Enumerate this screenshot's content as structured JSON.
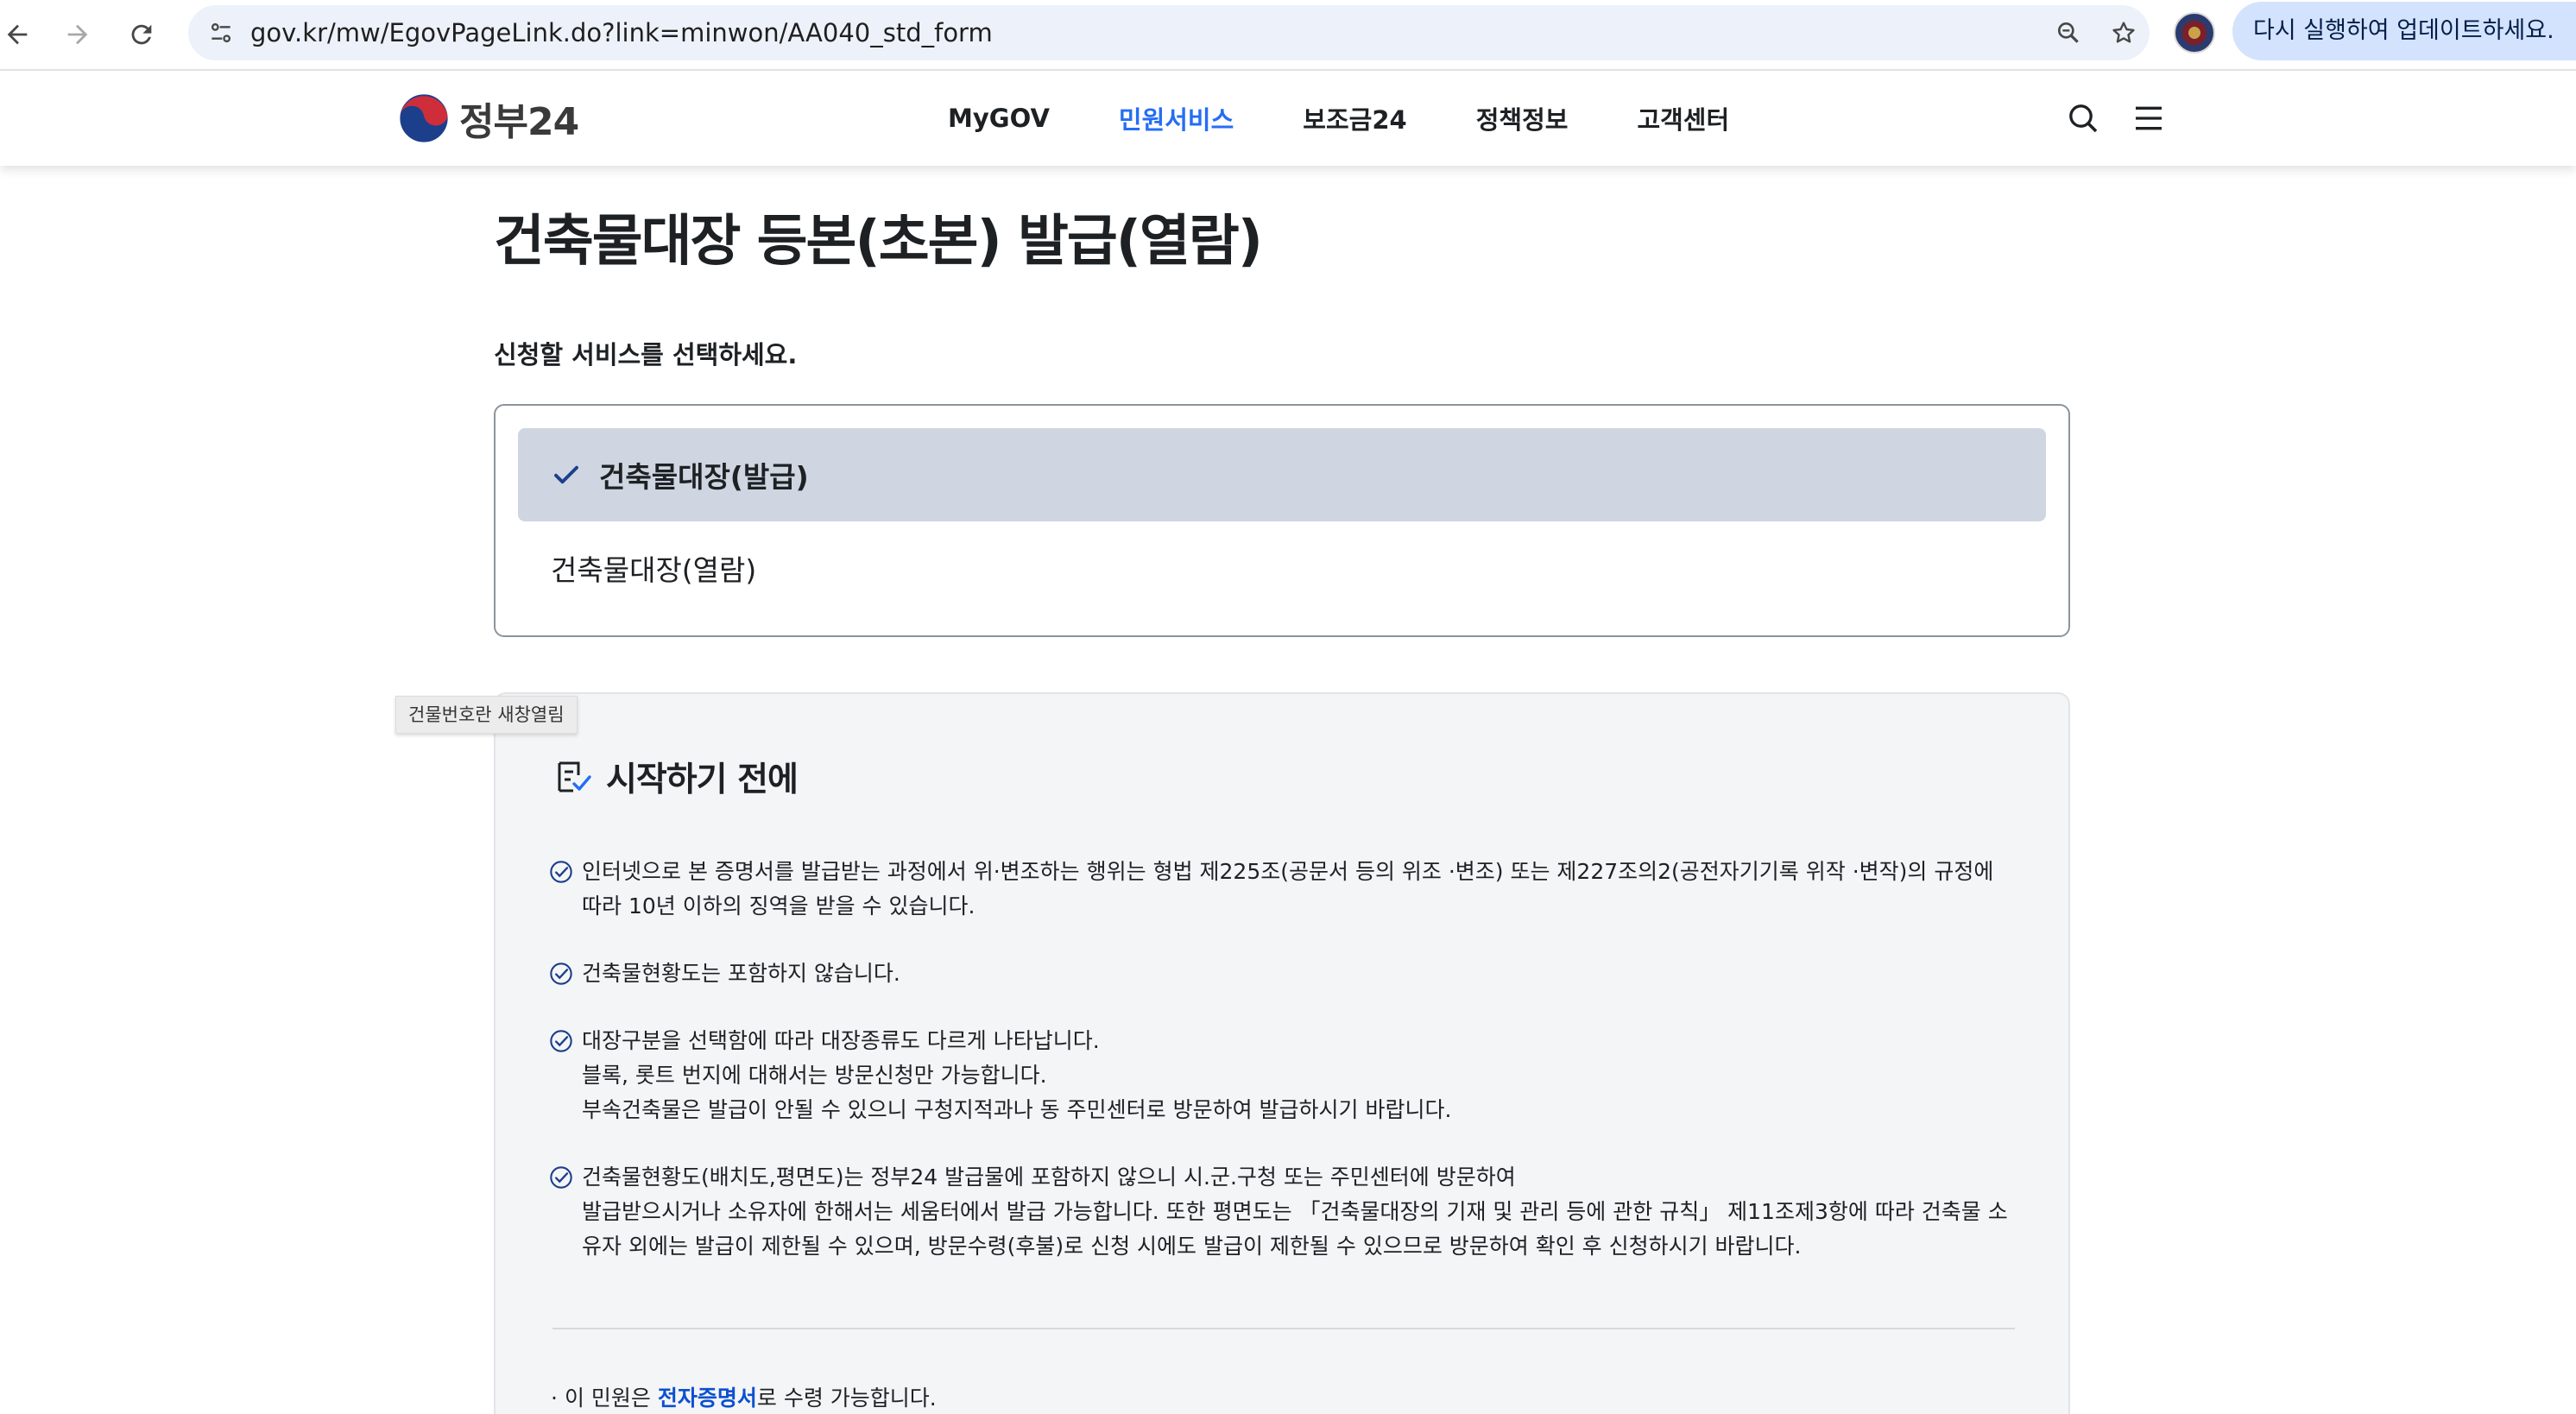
{
  "browser": {
    "url_host": "gov.kr",
    "url_path": "/mw/EgovPageLink.do?link=minwon/AA040_std_form",
    "update_button": "다시 실행하여 업데이트하세요.",
    "icons": [
      "back-icon",
      "forward-icon",
      "reload-icon",
      "site-info-icon",
      "zoom-icon",
      "bookmark-star-icon"
    ]
  },
  "header": {
    "logo_text": "정부24",
    "nav": [
      "MyGOV",
      "민원서비스",
      "보조금24",
      "정책정보",
      "고객센터"
    ],
    "active_nav": "민원서비스",
    "icons": [
      "search-icon",
      "menu-icon"
    ]
  },
  "main": {
    "title": "건축물대장 등본(초본) 발급(열람)",
    "select_heading": "신청할 서비스를 선택하세요.",
    "options": [
      {
        "label": "건축물대장(발급)",
        "selected": true
      },
      {
        "label": "건축물대장(열람)",
        "selected": false
      }
    ],
    "tooltip": "건물번호란 새창열림",
    "info": {
      "title": "시작하기 전에",
      "notices": [
        {
          "lines": [
            "인터넷으로 본 증명서를 발급받는 과정에서 위·변조하는 행위는 형법 제225조(공문서 등의 위조 ·변조) 또는 제227조의2(공전자기기록 위작 ·변작)의 규정에",
            "따라 10년 이하의 징역을 받을 수 있습니다."
          ]
        },
        {
          "lines": [
            "건축물현황도는 포함하지 않습니다."
          ]
        },
        {
          "lines": [
            "대장구분을 선택함에 따라 대장종류도 다르게 나타납니다.",
            "블록, 롯트 번지에 대해서는 방문신청만 가능합니다.",
            "부속건축물은 발급이 안될 수 있으니 구청지적과나 동 주민센터로 방문하여 발급하시기 바랍니다."
          ]
        },
        {
          "lines": [
            "건축물현황도(배치도,평면도)는 정부24 발급물에 포함하지 않으니 시.군.구청 또는 주민센터에 방문하여",
            "발급받으시거나 소유자에 한해서는 세움터에서 발급 가능합니다. 또한 평면도는 「건축물대장의 기재 및 관리 등에 관한 규칙」 제11조제3항에 따라 건축물 소",
            "유자 외에는 발급이 제한될 수 있으며, 방문수령(후불)로 신청 시에도 발급이 제한될 수 있으므로 방문하여 확인 후 신청하시기 바랍니다."
          ]
        }
      ],
      "footer_prefix": "이 민원은 ",
      "footer_link": "전자증명서",
      "footer_suffix": "로 수령 가능합니다."
    }
  },
  "colors": {
    "accent": "#256ef4",
    "selected_bg": "#cfd6e1",
    "info_bg": "#f4f5f6",
    "link": "#0b50d0"
  }
}
